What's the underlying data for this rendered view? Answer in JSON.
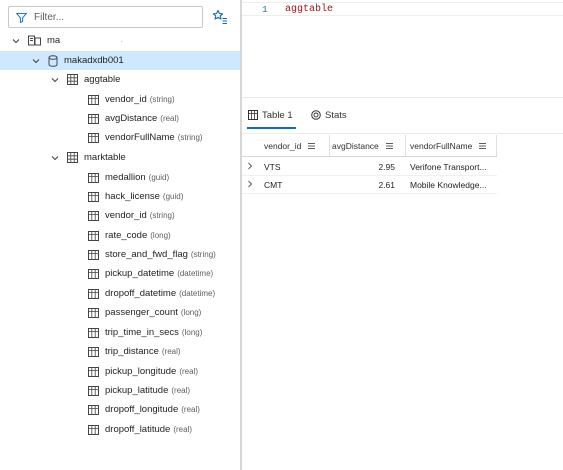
{
  "filter": {
    "placeholder": "Filter..."
  },
  "tree": {
    "cluster_label": "ma",
    "database": "makadxdb001",
    "tables": [
      {
        "name": "aggtable",
        "columns": [
          {
            "name": "vendor_id",
            "type": "(string)"
          },
          {
            "name": "avgDistance",
            "type": "(real)"
          },
          {
            "name": "vendorFullName",
            "type": "(string)"
          }
        ]
      },
      {
        "name": "marktable",
        "columns": [
          {
            "name": "medallion",
            "type": "(guid)"
          },
          {
            "name": "hack_license",
            "type": "(guid)"
          },
          {
            "name": "vendor_id",
            "type": "(string)"
          },
          {
            "name": "rate_code",
            "type": "(long)"
          },
          {
            "name": "store_and_fwd_flag",
            "type": "(string)"
          },
          {
            "name": "pickup_datetime",
            "type": "(datetime)"
          },
          {
            "name": "dropoff_datetime",
            "type": "(datetime)"
          },
          {
            "name": "passenger_count",
            "type": "(long)"
          },
          {
            "name": "trip_time_in_secs",
            "type": "(long)"
          },
          {
            "name": "trip_distance",
            "type": "(real)"
          },
          {
            "name": "pickup_longitude",
            "type": "(real)"
          },
          {
            "name": "pickup_latitude",
            "type": "(real)"
          },
          {
            "name": "dropoff_longitude",
            "type": "(real)"
          },
          {
            "name": "dropoff_latitude",
            "type": "(real)"
          }
        ]
      }
    ]
  },
  "editor": {
    "line_number": "1",
    "query": "aggtable"
  },
  "results": {
    "tabs": [
      {
        "label": "Table 1"
      },
      {
        "label": "Stats"
      }
    ],
    "columns": [
      "vendor_id",
      "avgDistance",
      "vendorFullName"
    ],
    "rows": [
      {
        "vendor_id": "VTS",
        "avgDistance": "2.95",
        "vendorFullName": "Verifone Transport..."
      },
      {
        "vendor_id": "CMT",
        "avgDistance": "2.61",
        "vendorFullName": "Mobile Knowledge..."
      }
    ]
  },
  "colors": {
    "selected_row": "#cde8ff",
    "accent": "#0f6cbd",
    "query_text": "#a31515"
  }
}
